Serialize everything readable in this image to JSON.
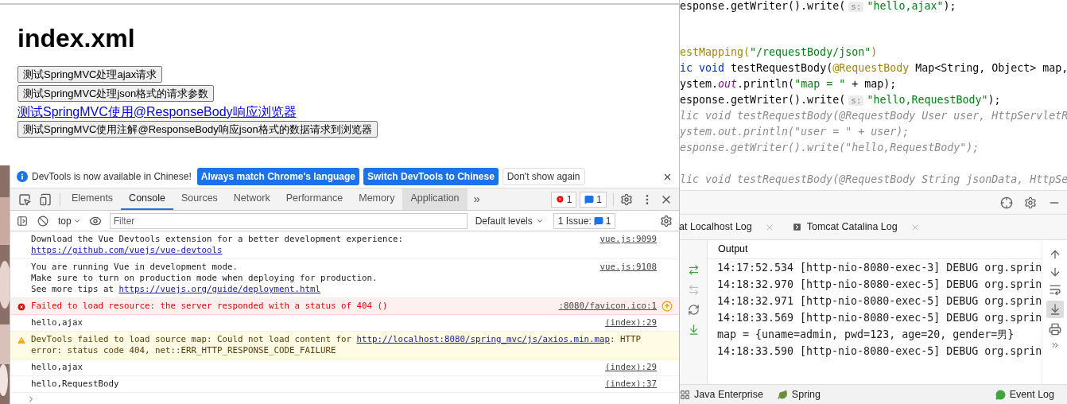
{
  "browser": {
    "heading": "index.xml",
    "controls": [
      {
        "kind": "button",
        "label": "测试SpringMVC处理ajax请求"
      },
      {
        "kind": "button",
        "label": "测试SpringMVC处理json格式的请求参数"
      },
      {
        "kind": "link",
        "label": "测试SpringMVC使用@ResponseBody响应浏览器"
      },
      {
        "kind": "button",
        "label": "测试SpringMVC使用注解@ResponseBody响应json格式的数据请求到浏览器"
      }
    ]
  },
  "devtools": {
    "infobar": {
      "message": "DevTools is now available in Chinese!",
      "buttons": [
        {
          "label": "Always match Chrome's language",
          "primary": true
        },
        {
          "label": "Switch DevTools to Chinese",
          "primary": true
        },
        {
          "label": "Don't show again",
          "primary": false
        }
      ]
    },
    "tabs": [
      {
        "label": "Elements",
        "selected": false,
        "hovered": false
      },
      {
        "label": "Console",
        "selected": true,
        "hovered": false
      },
      {
        "label": "Sources",
        "selected": false,
        "hovered": false
      },
      {
        "label": "Network",
        "selected": false,
        "hovered": false
      },
      {
        "label": "Performance",
        "selected": false,
        "hovered": false
      },
      {
        "label": "Memory",
        "selected": false,
        "hovered": false
      },
      {
        "label": "Application",
        "selected": false,
        "hovered": true
      }
    ],
    "more": "»",
    "error_count": "1",
    "message_count": "1",
    "console_toolbar": {
      "context": "top",
      "filter_placeholder": "Filter",
      "levels": "Default levels",
      "issues_label": "1 Issue:",
      "issues_count": "1"
    },
    "messages": [
      {
        "kind": "log",
        "lines": [
          [
            {
              "text": "Download the Vue Devtools extension for a better development experience:"
            }
          ],
          [
            {
              "text": "https://github.com/vuejs/vue-devtools",
              "link": true
            }
          ]
        ],
        "source": "vue.js:9099"
      },
      {
        "kind": "log",
        "lines": [
          [
            {
              "text": "You are running Vue in development mode."
            }
          ],
          [
            {
              "text": "Make sure to turn on production mode when deploying for production."
            }
          ],
          [
            {
              "text": "See more tips at "
            },
            {
              "text": "https://vuejs.org/guide/deployment.html",
              "link": true
            }
          ]
        ],
        "source": "vue.js:9108"
      },
      {
        "kind": "error",
        "lines": [
          [
            {
              "text": "Failed to load resource: the server responded with a status of 404 ()"
            }
          ]
        ],
        "source": ":8080/favicon.ico:1"
      },
      {
        "kind": "log",
        "lines": [
          [
            {
              "text": "hello,ajax"
            }
          ]
        ],
        "source": "(index):29"
      },
      {
        "kind": "warning",
        "lines": [
          [
            {
              "text": "DevTools failed to load source map: Could not load content for "
            },
            {
              "text": "http://localhost:8080/spring_mvc/js/axios.min.map",
              "link": true
            },
            {
              "text": ": HTTP"
            }
          ],
          [
            {
              "text": "error: status code 404, net::ERR_HTTP_RESPONSE_CODE_FAILURE"
            }
          ]
        ]
      },
      {
        "kind": "log",
        "lines": [
          [
            {
              "text": "hello,ajax"
            }
          ]
        ],
        "source": "(index):29"
      },
      {
        "kind": "log",
        "lines": [
          [
            {
              "text": "hello,RequestBody"
            }
          ]
        ],
        "source": "(index):37"
      }
    ]
  },
  "ide": {
    "code_lines": [
      {
        "kind": "code",
        "segments": [
          {
            "kind": "plain",
            "text": "esponse.getWriter().write("
          },
          {
            "kind": "hint",
            "text": "s:"
          },
          {
            "kind": "string",
            "text": "\"hello,ajax\""
          },
          {
            "kind": "plain",
            "text": ");"
          }
        ]
      },
      {
        "kind": "blank"
      },
      {
        "kind": "blank"
      },
      {
        "kind": "code",
        "segments": [
          {
            "kind": "annotation",
            "text": "estMapping("
          },
          {
            "kind": "string",
            "text": "\"/requestBody/json\""
          },
          {
            "kind": "annotation",
            "text": ")"
          }
        ]
      },
      {
        "kind": "code",
        "segments": [
          {
            "kind": "keyword",
            "text": "ic void"
          },
          {
            "kind": "plain",
            "text": " testRequestBody("
          },
          {
            "kind": "annotation",
            "text": "@RequestBody"
          },
          {
            "kind": "plain",
            "text": " Map<String, Object> map,"
          }
        ]
      },
      {
        "kind": "code",
        "segments": [
          {
            "kind": "plain",
            "text": "ystem."
          },
          {
            "kind": "field",
            "text": "out"
          },
          {
            "kind": "plain",
            "text": ".println("
          },
          {
            "kind": "string",
            "text": "\"map = \""
          },
          {
            "kind": "plain",
            "text": " + map);"
          }
        ]
      },
      {
        "kind": "code",
        "segments": [
          {
            "kind": "plain",
            "text": "esponse.getWriter().write("
          },
          {
            "kind": "hint",
            "text": "s:"
          },
          {
            "kind": "string",
            "text": "\"hello,RequestBody\""
          },
          {
            "kind": "plain",
            "text": ");"
          }
        ]
      },
      {
        "kind": "code",
        "segments": [
          {
            "kind": "disabled",
            "text": "lic void testRequestBody(@RequestBody User user, HttpServletR"
          }
        ]
      },
      {
        "kind": "code",
        "segments": [
          {
            "kind": "disabled",
            "text": "ystem.out.println(\"user = \" + user);"
          }
        ]
      },
      {
        "kind": "code",
        "segments": [
          {
            "kind": "disabled",
            "text": "esponse.getWriter().write(\"hello,RequestBody\");"
          }
        ]
      },
      {
        "kind": "blank"
      },
      {
        "kind": "code",
        "segments": [
          {
            "kind": "disabled",
            "text": "lic void testRequestBody(@RequestBody String jsonData, HttpSe"
          }
        ]
      }
    ],
    "tool_tabs": [
      {
        "label": "at Localhost Log"
      },
      {
        "label": "Tomcat Catalina Log"
      }
    ],
    "output_label": "Output",
    "log_lines": [
      "14:17:52.534 [http-nio-8080-exec-3] DEBUG org.sprin",
      "14:18:32.970 [http-nio-8080-exec-5] DEBUG org.sprin",
      "14:18:32.971 [http-nio-8080-exec-5] DEBUG org.sprin",
      "14:18:33.569 [http-nio-8080-exec-5] DEBUG org.sprin",
      "map = {uname=admin, pwd=123, age=20, gender=男}",
      "14:18:33.590 [http-nio-8080-exec-5] DEBUG org.sprin"
    ],
    "scroll_to_end_selected": true,
    "status_items": [
      {
        "kind": "enterprise",
        "label": "Java Enterprise"
      },
      {
        "kind": "spring",
        "label": "Spring"
      },
      {
        "kind": "events",
        "label": "Event Log"
      }
    ]
  }
}
